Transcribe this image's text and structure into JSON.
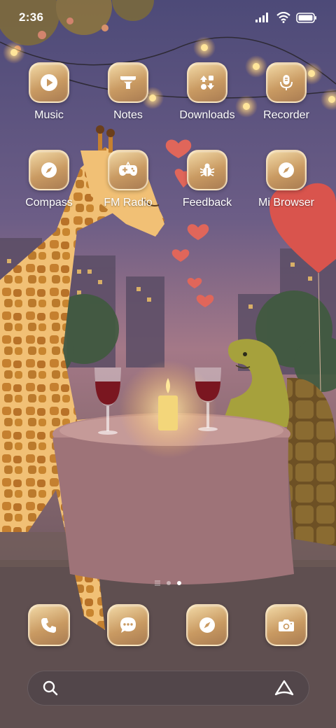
{
  "status_bar": {
    "time": "2:36",
    "icons": [
      "signal-icon",
      "wifi-icon",
      "battery-icon"
    ]
  },
  "apps": [
    {
      "label": "Music",
      "icon": "play-icon"
    },
    {
      "label": "Notes",
      "icon": "funnel-icon"
    },
    {
      "label": "Downloads",
      "icon": "transfer-icon"
    },
    {
      "label": "Recorder",
      "icon": "microphone-icon"
    },
    {
      "label": "Compass",
      "icon": "compass-icon"
    },
    {
      "label": "FM Radio",
      "icon": "gamepad-icon"
    },
    {
      "label": "Feedback",
      "icon": "bug-icon"
    },
    {
      "label": "Mi Browser",
      "icon": "compass-icon"
    }
  ],
  "page_indicator": {
    "pages": 2,
    "current": 2
  },
  "dock": [
    {
      "icon": "phone-icon"
    },
    {
      "icon": "message-icon"
    },
    {
      "icon": "compass-icon"
    },
    {
      "icon": "camera-icon"
    }
  ],
  "search": {
    "icon": "search-icon",
    "assistant_icon": "assistant-icon"
  },
  "colors": {
    "icon_tint": "#c99a62",
    "icon_glyph": "#ffffff",
    "label": "#ffffff"
  }
}
